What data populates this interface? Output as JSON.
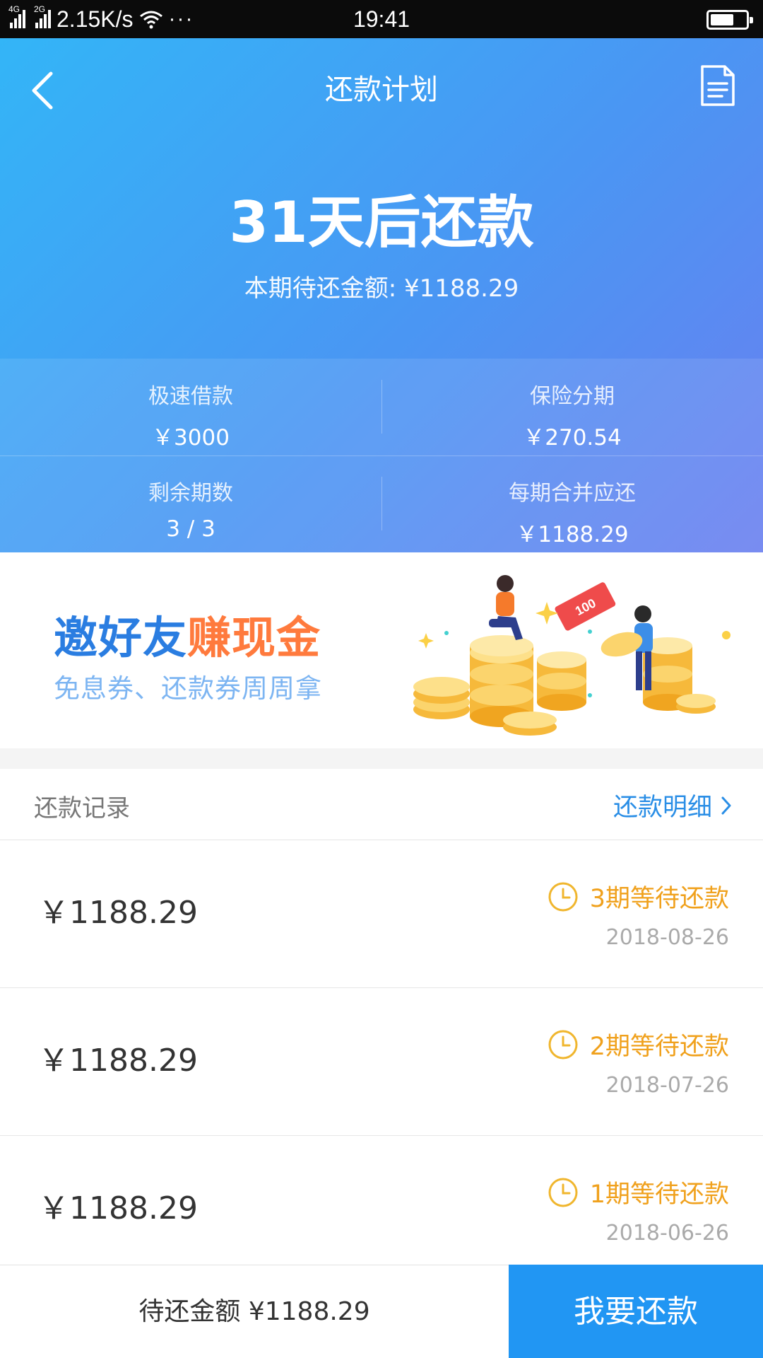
{
  "status_bar": {
    "net1": "4G",
    "net2": "2G",
    "speed": "2.15K/s",
    "dots": "···",
    "time": "19:41",
    "battery_level": 0.7
  },
  "header": {
    "title": "还款计划",
    "back_icon": "chevron-left-icon",
    "doc_icon": "document-icon"
  },
  "hero": {
    "countdown": "31天后还款",
    "current_due": "本期待还金额: ¥1188.29"
  },
  "stats": [
    {
      "label": "极速借款",
      "value": "￥3000"
    },
    {
      "label": "保险分期",
      "value": "￥270.54"
    },
    {
      "label": "剩余期数",
      "value": "3 / 3"
    },
    {
      "label": "每期合并应还",
      "value": "￥1188.29"
    }
  ],
  "banner": {
    "title_part1": "邀好友",
    "title_part2": "赚现金",
    "subtitle": "免息券、还款券周周拿",
    "ticket_text": "100"
  },
  "records": {
    "title": "还款记录",
    "detail_link": "还款明细",
    "items": [
      {
        "amount": "￥1188.29",
        "status": "3期等待还款",
        "date": "2018-08-26"
      },
      {
        "amount": "￥1188.29",
        "status": "2期等待还款",
        "date": "2018-07-26"
      },
      {
        "amount": "￥1188.29",
        "status": "1期等待还款",
        "date": "2018-06-26"
      }
    ]
  },
  "bottom": {
    "pending": "待还金额 ¥1188.29",
    "pay_button": "我要还款"
  },
  "colors": {
    "accent_blue": "#2196f3",
    "status_orange": "#f0a11d",
    "link_blue": "#2a8ee6"
  }
}
